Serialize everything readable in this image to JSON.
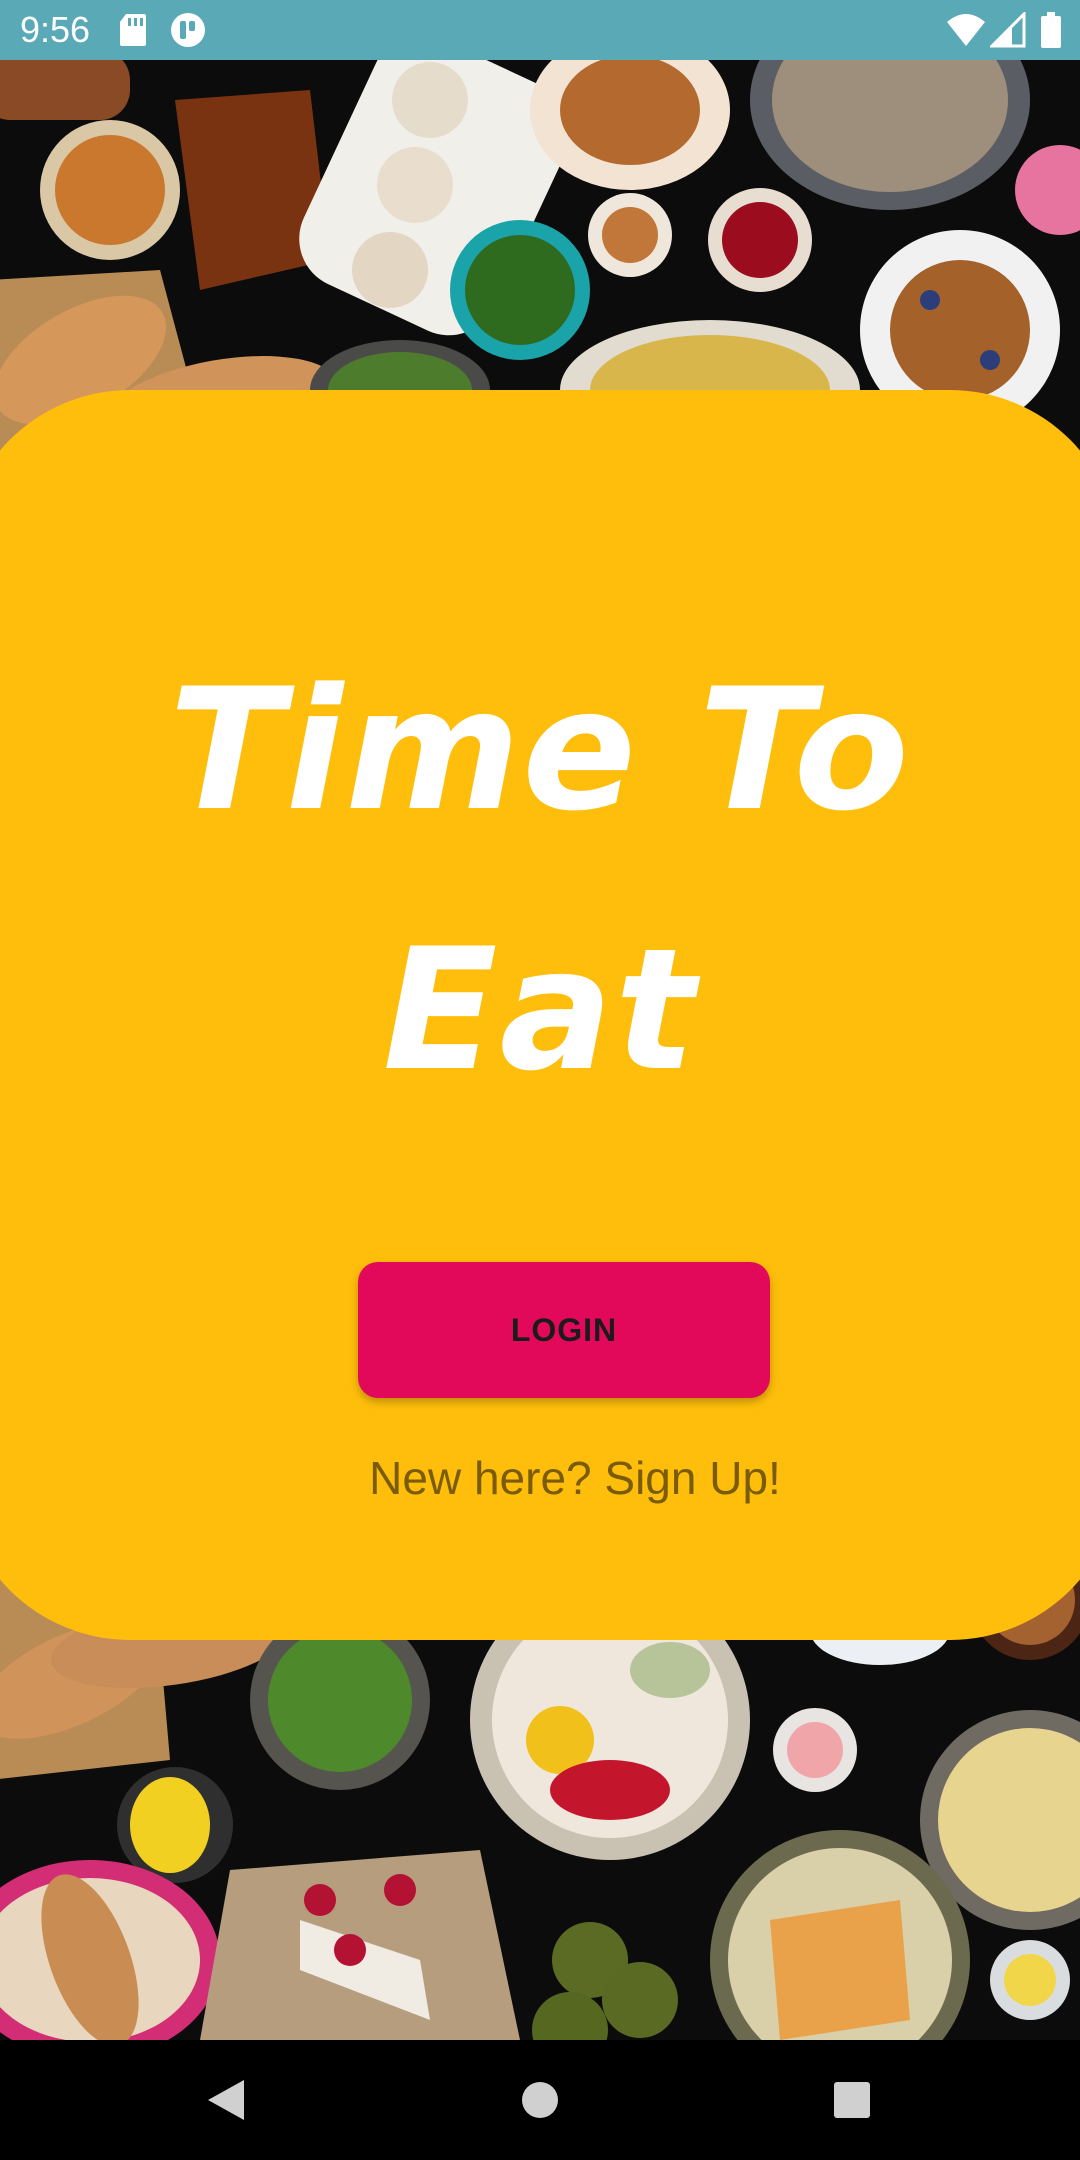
{
  "status_bar": {
    "time": "9:56",
    "icons": [
      "sd-card-icon",
      "notification-app-icon",
      "wifi-icon",
      "signal-icon",
      "battery-icon"
    ]
  },
  "app": {
    "title_line_1": "Time To",
    "title_line_2": "Eat",
    "login_label": "LOGIN",
    "signup_text": "New here? Sign Up!"
  },
  "colors": {
    "status_bar": "#5aa9b6",
    "card": "#ffbe0b",
    "login_button": "#e2095a",
    "title_text": "#ffffff",
    "signup_text": "#7a5c07"
  },
  "nav_bar": {
    "buttons": [
      "back-icon",
      "home-icon",
      "recents-icon"
    ]
  }
}
